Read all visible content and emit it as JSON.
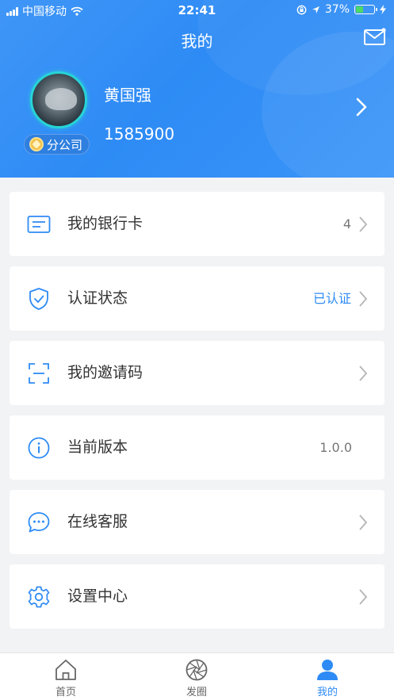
{
  "status_bar": {
    "carrier": "中国移动",
    "time": "22:41",
    "battery": "37%"
  },
  "header": {
    "title": "我的",
    "mail_icon": "mail-icon"
  },
  "profile": {
    "name": "黄国强",
    "phone": "1585900",
    "badge": "分公司"
  },
  "menu": [
    {
      "label": "我的银行卡",
      "value": "4",
      "icon": "card-icon"
    },
    {
      "label": "认证状态",
      "value": "已认证",
      "icon": "shield-check-icon"
    },
    {
      "label": "我的邀请码",
      "value": "",
      "icon": "scan-icon"
    },
    {
      "label": "当前版本",
      "value": "1.0.0",
      "icon": "info-icon"
    },
    {
      "label": "在线客服",
      "value": "",
      "icon": "chat-icon"
    },
    {
      "label": "设置中心",
      "value": "",
      "icon": "gear-icon"
    }
  ],
  "tabbar": [
    {
      "label": "首页",
      "icon": "home-icon"
    },
    {
      "label": "发圈",
      "icon": "aperture-icon"
    },
    {
      "label": "我的",
      "icon": "user-icon",
      "active": true
    }
  ],
  "colors": {
    "accent": "#2e8bf5",
    "header_bg": "#3a95f8",
    "page_bg": "#f2f3f5",
    "teal_ring": "#27d3d6"
  }
}
